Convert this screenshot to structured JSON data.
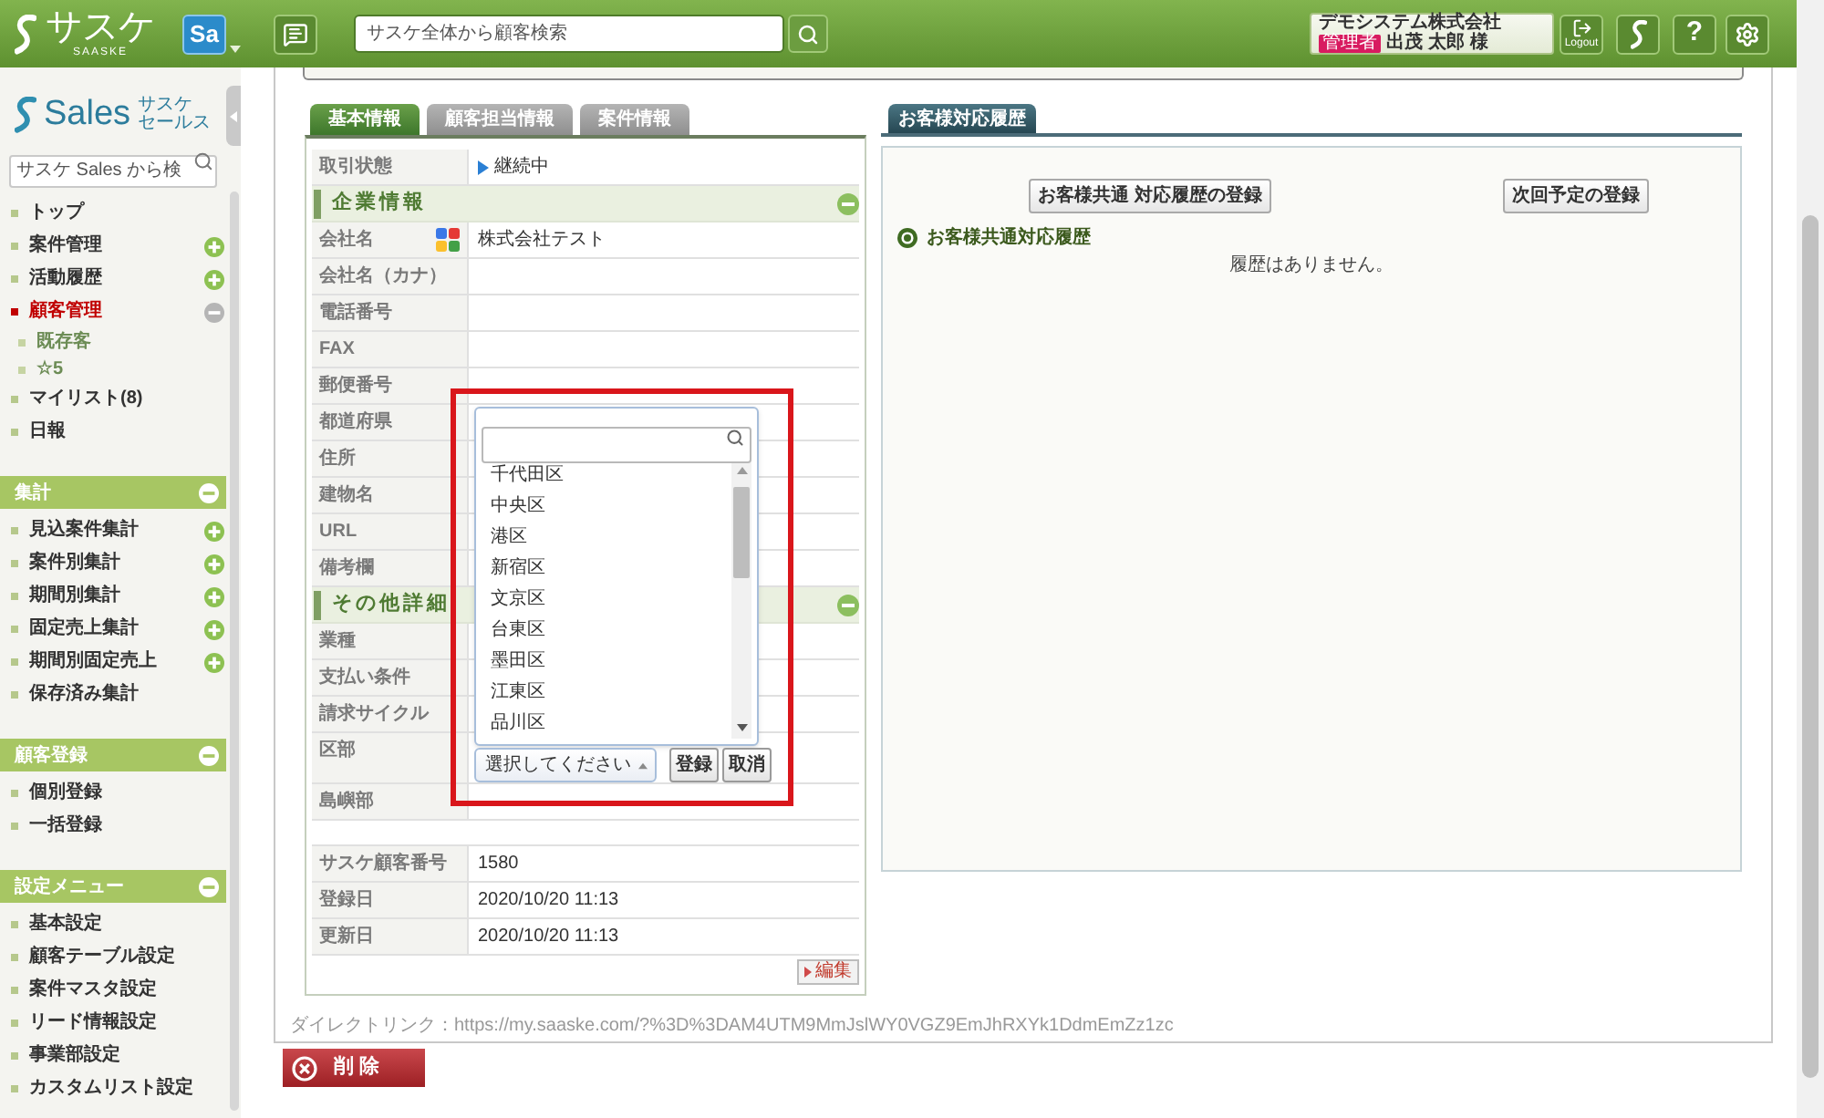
{
  "header": {
    "logo": "サスケ",
    "logo_sub": "SAASKE",
    "app_badge": "Sa",
    "search": {
      "placeholder": "サスケ全体から顧客検索"
    },
    "account": {
      "company": "デモシステム株式会社",
      "role": "管理者",
      "name": "出茂 太郎",
      "honorific": "様"
    },
    "logout_label": "Logout",
    "help_label": "?"
  },
  "sidebar": {
    "brand": {
      "name": "Sales",
      "sub": [
        "サスケ",
        "セールス"
      ]
    },
    "search": {
      "placeholder": "サスケ Sales から検"
    },
    "groups": [
      {
        "items": [
          {
            "label": "トップ",
            "selected": false
          },
          {
            "label": "案件管理",
            "selected": false,
            "expanded": false
          },
          {
            "label": "活動履歴",
            "selected": false,
            "expanded": false
          },
          {
            "label": "顧客管理",
            "selected": true,
            "expanded": true,
            "children": [
              {
                "label": "既存客",
                "selected": false
              },
              {
                "label": "☆5",
                "selected": false
              }
            ]
          },
          {
            "label": "マイリスト(8)",
            "selected": false
          },
          {
            "label": "日報",
            "selected": false
          }
        ]
      },
      {
        "title": "集計",
        "expanded": true,
        "items": [
          {
            "label": "見込案件集計",
            "selected": false,
            "expanded": false
          },
          {
            "label": "案件別集計",
            "selected": false,
            "expanded": false
          },
          {
            "label": "期間別集計",
            "selected": false,
            "expanded": false
          },
          {
            "label": "固定売上集計",
            "selected": false,
            "expanded": false
          },
          {
            "label": "期間別固定売上",
            "selected": false,
            "expanded": false
          },
          {
            "label": "保存済み集計",
            "selected": false
          }
        ]
      },
      {
        "title": "顧客登録",
        "expanded": true,
        "items": [
          {
            "label": "個別登録",
            "selected": false
          },
          {
            "label": "一括登録",
            "selected": false
          }
        ]
      },
      {
        "title": "設定メニュー",
        "expanded": true,
        "items": [
          {
            "label": "基本設定",
            "selected": false
          },
          {
            "label": "顧客テーブル設定",
            "selected": false
          },
          {
            "label": "案件マスタ設定",
            "selected": false
          },
          {
            "label": "リード情報設定",
            "selected": false
          },
          {
            "label": "事業部設定",
            "selected": false
          },
          {
            "label": "カスタムリスト設定",
            "selected": false
          }
        ]
      }
    ]
  },
  "detail_tabs": [
    {
      "label": "基本情報",
      "selected": true
    },
    {
      "label": "顧客担当情報",
      "selected": false
    },
    {
      "label": "案件情報",
      "selected": false
    }
  ],
  "detail": {
    "rows": [
      {
        "kind": "status",
        "label": "取引状態",
        "value": "継続中"
      },
      {
        "kind": "section",
        "label": "企業情報",
        "expanded": true
      },
      {
        "kind": "lookup",
        "label": "会社名",
        "value": "株式会社テスト"
      },
      {
        "kind": "field",
        "label": "会社名（カナ）"
      },
      {
        "kind": "field",
        "label": "電話番号"
      },
      {
        "kind": "field",
        "label": "FAX"
      },
      {
        "kind": "field",
        "label": "郵便番号"
      },
      {
        "kind": "field",
        "label": "都道府県"
      },
      {
        "kind": "field",
        "label": "住所"
      },
      {
        "kind": "field",
        "label": "建物名"
      },
      {
        "kind": "field",
        "label": "URL"
      },
      {
        "kind": "field",
        "label": "備考欄"
      },
      {
        "kind": "section",
        "label": "その他詳細",
        "expanded": true
      },
      {
        "kind": "field",
        "label": "業種"
      },
      {
        "kind": "field",
        "label": "支払い条件"
      },
      {
        "kind": "field",
        "label": "請求サイクル"
      },
      {
        "kind": "select",
        "label": "区部",
        "editor": {
          "highlighted": true,
          "options": [
            "千代田区",
            "中央区",
            "港区",
            "新宿区",
            "文京区",
            "台東区",
            "墨田区",
            "江東区",
            "品川区"
          ],
          "select": "選択してください",
          "buttons": [
            "登録",
            "取消"
          ]
        }
      },
      {
        "kind": "field",
        "label": "島嶼部"
      }
    ],
    "meta_rows": [
      {
        "label": "サスケ顧客番号",
        "value": "1580"
      },
      {
        "label": "登録日",
        "value": "2020/10/20 11:13"
      },
      {
        "label": "更新日",
        "value": "2020/10/20 11:13"
      }
    ],
    "edit_button": "編集"
  },
  "history": {
    "tab": "お客様対応履歴",
    "buttons": [
      "お客様共通 対応履歴の登録",
      "次回予定の登録"
    ],
    "title": "お客様共通対応履歴",
    "empty_text": "履歴はありません。"
  },
  "direct_link": "ダイレクトリンク：https://my.saaske.com/?%3D%3DAM4UTM9MmJslWY0VGZ9EmJhRXYk1DdmEmZz1zc",
  "delete_button": "削 除"
}
